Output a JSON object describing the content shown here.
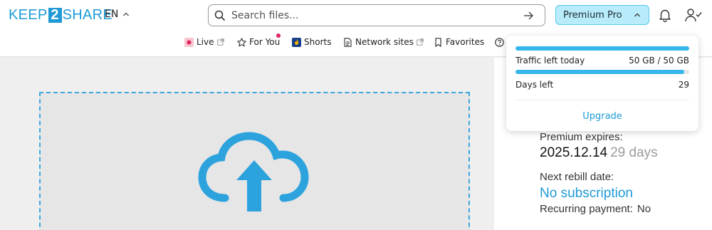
{
  "header": {
    "logo": {
      "left": "KEEP",
      "mid": "2",
      "right": "SHARE"
    },
    "language": "EN",
    "search": {
      "placeholder": "Search files...",
      "value": ""
    },
    "premium_label": "Premium Pro"
  },
  "nav": {
    "items": [
      {
        "label": "Live",
        "icon": "live-icon",
        "external": true
      },
      {
        "label": "For You",
        "icon": "star-icon",
        "badge": true
      },
      {
        "label": "Shorts",
        "icon": "shorts-icon"
      },
      {
        "label": "Network sites",
        "icon": "document-icon",
        "external": true
      },
      {
        "label": "Favorites",
        "icon": "bookmark-icon"
      },
      {
        "label": "",
        "icon": "help-icon"
      }
    ]
  },
  "dropdown": {
    "traffic_label": "Traffic left today",
    "traffic_value": "50 GB / 50 GB",
    "traffic_fraction": 1.0,
    "days_label": "Days left",
    "days_value": "29",
    "days_fraction": 0.97,
    "upgrade_label": "Upgrade"
  },
  "account": {
    "expires_label": "Premium expires:",
    "expires_date": "2025.12.14",
    "expires_days": "29 days",
    "rebill_label": "Next rebill date:",
    "rebill_value": "No subscription",
    "recurring_label": "Recurring payment:",
    "recurring_value": "No"
  },
  "colors": {
    "accent": "#1f9ad6",
    "premium_bg": "#b8ecfa",
    "progress": "#35b6ec",
    "badge": "#e0245e"
  }
}
